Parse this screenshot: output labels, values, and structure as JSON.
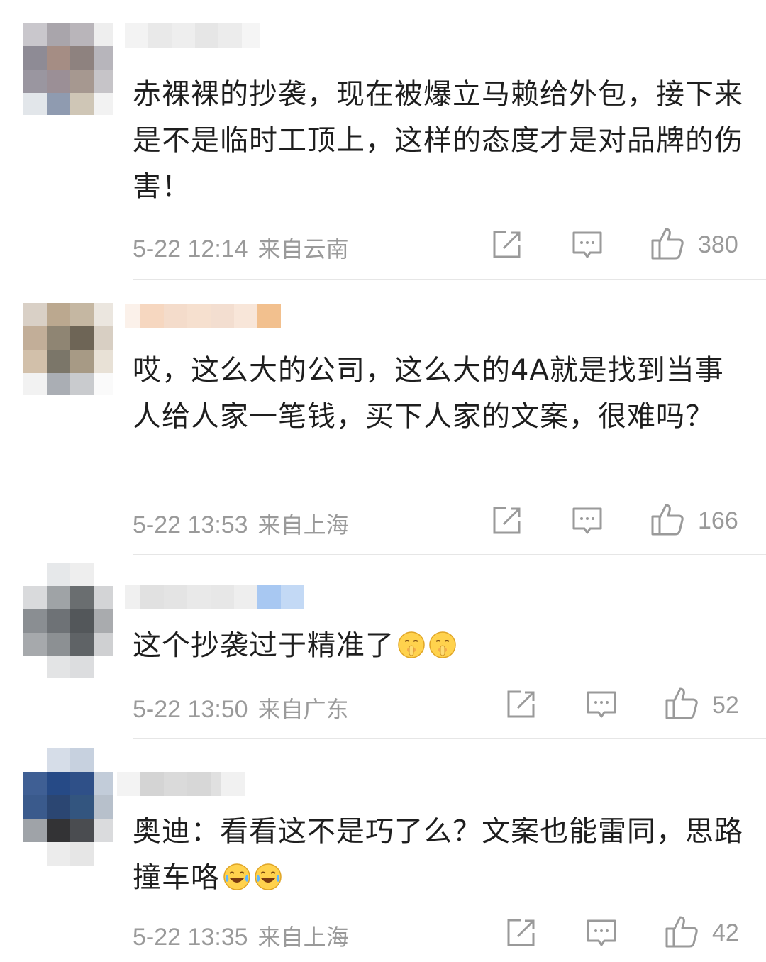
{
  "comments": [
    {
      "text": "赤裸裸的抄袭，现在被爆立马赖给外包，接下来是不是临时工顶上，这样的态度才是对品牌的伤害！",
      "time": "5-22 12:14",
      "location": "来自云南",
      "likes": "380",
      "emojis": []
    },
    {
      "text": "哎，这么大的公司，这么大的4A就是找到当事人给人家一笔钱，买下人家的文案，很难吗？",
      "time": "5-22 13:53",
      "location": "来自上海",
      "likes": "166",
      "emojis": []
    },
    {
      "text": "这个抄袭过于精准了",
      "time": "5-22 13:50",
      "location": "来自广东",
      "likes": "52",
      "emojis": [
        "shush-face-emoji",
        "shush-face-emoji"
      ]
    },
    {
      "text": "奥迪：看看这不是巧了么？文案也能雷同，思路撞车咯",
      "time": "5-22 13:35",
      "location": "来自上海",
      "likes": "42",
      "emojis": [
        "crying-laughing-emoji",
        "crying-laughing-emoji"
      ]
    }
  ],
  "icons": {
    "share": "share-icon",
    "reply": "comment-icon",
    "like": "thumbs-up-icon"
  },
  "colors": {
    "meta_text": "#9a9a9a",
    "body_text": "#1e1e1e",
    "divider": "#e6e6e6"
  }
}
